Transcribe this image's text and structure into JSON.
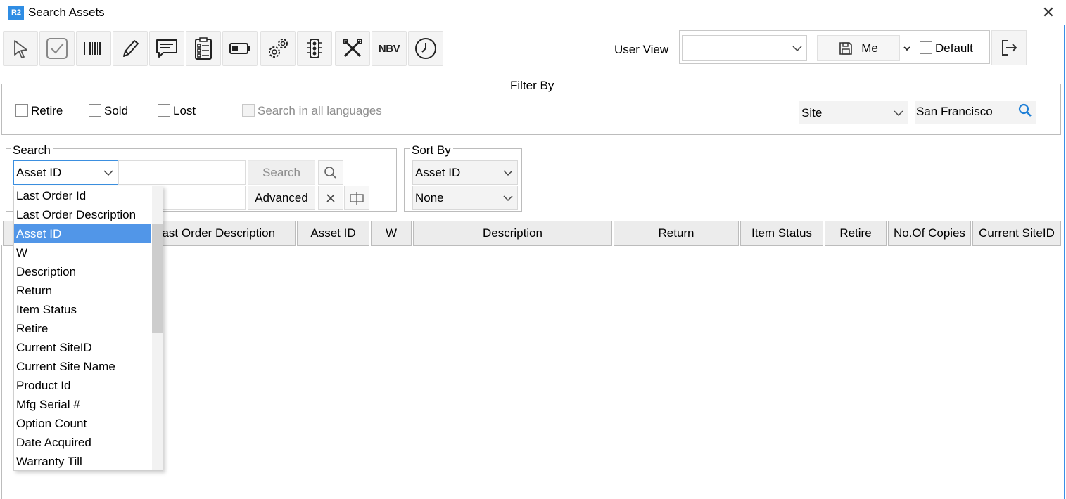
{
  "window": {
    "logo": "R2",
    "title": "Search Assets"
  },
  "toolbar": {
    "buttons": [
      {
        "name": "select-arrow-icon"
      },
      {
        "name": "checkbox-icon"
      },
      {
        "name": "barcode-icon"
      },
      {
        "name": "pencil-icon"
      },
      {
        "name": "comment-icon"
      },
      {
        "name": "checklist-icon"
      },
      {
        "name": "battery-icon"
      },
      {
        "name": "gears-icon"
      },
      {
        "name": "traffic-light-icon"
      },
      {
        "name": "tools-icon"
      },
      {
        "name": "nbv-button",
        "label": "NBV"
      },
      {
        "name": "clock-icon"
      }
    ]
  },
  "user_view": {
    "label": "User View",
    "selected": "",
    "me_label": "Me",
    "default_label": "Default",
    "default_checked": false
  },
  "filter": {
    "title": "Filter By",
    "retire_label": "Retire",
    "sold_label": "Sold",
    "lost_label": "Lost",
    "all_languages_label": "Search in all languages",
    "scope_select": "Site",
    "scope_value": "San Francisco"
  },
  "search": {
    "title": "Search",
    "field_select": "Asset ID",
    "search_button": "Search",
    "advanced_button": "Advanced"
  },
  "sort": {
    "title": "Sort By",
    "primary": "Asset ID",
    "secondary": "None"
  },
  "grid": {
    "columns": [
      "Last Order Description",
      "Asset ID",
      "W",
      "Description",
      "Return",
      "Item Status",
      "Retire",
      "No.Of Copies",
      "Current SiteID"
    ]
  },
  "dropdown": {
    "selected_index": 2,
    "items": [
      "Last Order Id",
      "Last Order Description",
      "Asset ID",
      "W",
      "Description",
      "Return",
      "Item Status",
      "Retire",
      "Current SiteID",
      "Current Site Name",
      "Product Id",
      "Mfg Serial #",
      "Option Count",
      "Date Acquired",
      "Warranty Till"
    ]
  },
  "colors": {
    "accent": "#3b8fe0",
    "selection": "#5196e8",
    "logo": "#2f8de4"
  }
}
